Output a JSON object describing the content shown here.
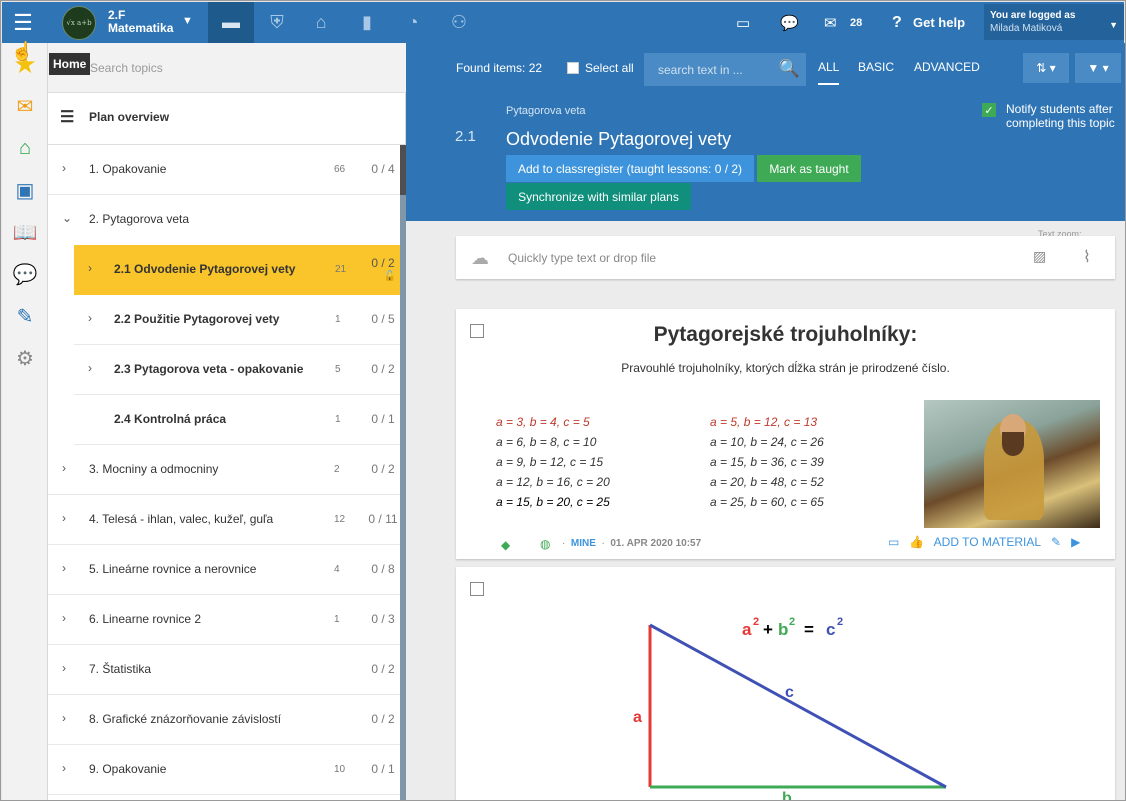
{
  "topbar": {
    "class_name": "2.F",
    "subject": "Matematika",
    "avatar_text": "√x  a+b",
    "messages_count": "28",
    "help_label": "Get help",
    "logged_in_label": "You are logged as",
    "user_name": "Milada Matiková"
  },
  "rail": {
    "tooltip": "Home"
  },
  "plan": {
    "search_placeholder": "Search topics",
    "overview_label": "Plan overview",
    "topics": [
      {
        "label": "1. Opakovanie",
        "count": "66",
        "progress": "0 / 4"
      },
      {
        "label": "2. Pytagorova veta",
        "count": "",
        "progress": ""
      },
      {
        "num": "2.1",
        "label": "Odvodenie Pytagorovej vety",
        "count": "21",
        "progress": "0 / 2"
      },
      {
        "num": "2.2",
        "label": "Použitie Pytagorovej vety",
        "count": "1",
        "progress": "0 / 5"
      },
      {
        "num": "2.3",
        "label": "Pytagorova veta - opakovanie",
        "count": "5",
        "progress": "0 / 2"
      },
      {
        "num": "2.4",
        "label": "Kontrolná práca",
        "count": "1",
        "progress": "0 / 1"
      },
      {
        "label": "3. Mocniny a odmocniny",
        "count": "2",
        "progress": "0 / 2"
      },
      {
        "label": "4. Telesá - ihlan, valec, kužeľ, guľa",
        "count": "12",
        "progress": "0 / 11"
      },
      {
        "label": "5. Lineárne rovnice a nerovnice",
        "count": "4",
        "progress": "0 / 8"
      },
      {
        "label": "6. Linearne rovnice 2",
        "count": "1",
        "progress": "0 / 3"
      },
      {
        "label": "7. Štatistika",
        "count": "",
        "progress": "0 / 2"
      },
      {
        "label": "8. Grafické znázorňovanie závislostí",
        "count": "",
        "progress": "0 / 2"
      },
      {
        "label": "9. Opakovanie",
        "count": "10",
        "progress": "0 / 1"
      }
    ]
  },
  "toolbar": {
    "found": "Found items: 22",
    "select_all": "Select all",
    "search_placeholder": "search text in ...",
    "tab_all": "ALL",
    "tab_basic": "BASIC",
    "tab_advanced": "ADVANCED"
  },
  "header": {
    "parent_topic": "Pytagorova veta",
    "number": "2.1",
    "title": "Odvodenie Pytagorovej vety",
    "add_register": "Add to classregister (taught lessons: 0 / 2)",
    "mark_taught": "Mark as taught",
    "synchronize": "Synchronize with similar plans",
    "notify": "Notify students after completing this topic",
    "text_zoom": "Text zoom:"
  },
  "quick_input": {
    "placeholder": "Quickly type text or drop file"
  },
  "card1": {
    "title": "Pytagorejské trojuholníky:",
    "subtitle": "Pravouhlé trojuholníky, ktorých dĺžka strán je prirodzené číslo.",
    "col1": [
      "a = 3,    b = 4,     c = 5",
      "a = 6,    b = 8,     c = 10",
      "a = 9,    b = 12,   c = 15",
      "a = 12,  b = 16,   c = 20",
      "a = 15,  b = 20,   c = 25"
    ],
    "col2": [
      "a = 5,    b = 12,   c = 13",
      "a = 10,  b = 24,   c = 26",
      "a = 15,  b = 36,   c = 39",
      "a = 20,  b = 48,   c = 52",
      "a = 25,  b = 60,   c = 65"
    ],
    "owner": "MINE",
    "date": "01. APR 2020 10:57",
    "add_to_material": "ADD TO MATERIAL"
  },
  "card2": {
    "label_a": "a",
    "label_b": "b",
    "label_c": "c",
    "formula_a": "a",
    "formula_b": "b",
    "formula_c": "c",
    "formula_exp": "2",
    "formula_plus": "+",
    "formula_eq": "="
  },
  "colors": {
    "brand_blue": "#2f75b5",
    "highlight": "#f9c52b",
    "green": "#3eaa55",
    "teal": "#0f8f7c"
  }
}
